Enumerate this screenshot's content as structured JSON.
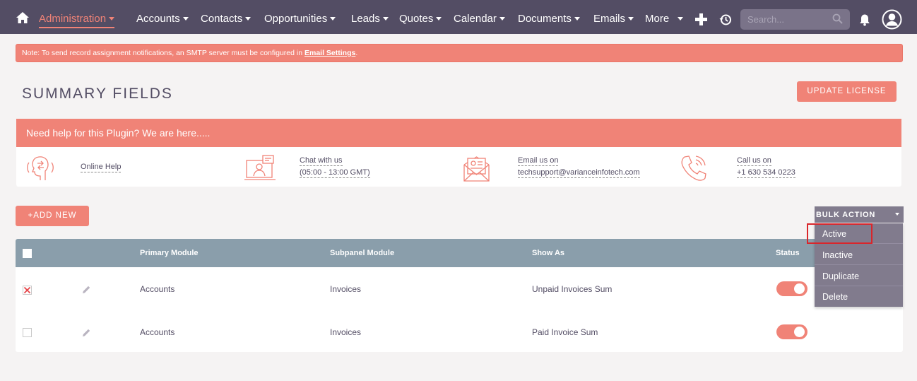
{
  "nav": {
    "items": [
      {
        "label": "Administration",
        "active": true
      },
      {
        "label": "Accounts"
      },
      {
        "label": "Contacts"
      },
      {
        "label": "Opportunities"
      },
      {
        "label": "Leads"
      },
      {
        "label": "Quotes"
      },
      {
        "label": "Calendar"
      },
      {
        "label": "Documents"
      },
      {
        "label": "Emails"
      },
      {
        "label": "More"
      }
    ],
    "search_placeholder": "Search...",
    "icons": [
      "home-icon",
      "plus-icon",
      "history-icon",
      "search-icon",
      "bell-icon",
      "user-icon"
    ]
  },
  "alert": {
    "text": "Note: To send record assignment notifications, an SMTP server must be configured in ",
    "link": "Email Settings",
    "suffix": "."
  },
  "page": {
    "title": "SUMMARY FIELDS",
    "update_license": "UPDATE LICENSE"
  },
  "help": {
    "header": "Need help for this Plugin? We are here.....",
    "online": "Online Help",
    "chat_title": "Chat with us",
    "chat_hours": "(05:00 - 13:00 GMT)",
    "email_title": "Email us on",
    "email": "techsupport@varianceinfotech.com",
    "call_title": "Call us on",
    "phone": "+1 630 534 0223"
  },
  "actions": {
    "add_new": "+ADD NEW",
    "bulk_action": "BULK ACTION",
    "bulk_items": [
      "Active",
      "Inactive",
      "Duplicate",
      "Delete"
    ],
    "highlighted": "Active"
  },
  "table": {
    "headers": {
      "primary": "Primary Module",
      "subpanel": "Subpanel Module",
      "show_as": "Show As",
      "status": "Status"
    },
    "rows": [
      {
        "checked": true,
        "primary": "Accounts",
        "subpanel": "Invoices",
        "show_as": "Unpaid Invoices Sum",
        "status": true
      },
      {
        "checked": false,
        "primary": "Accounts",
        "subpanel": "Invoices",
        "show_as": "Paid Invoice Sum",
        "status": true
      }
    ]
  },
  "colors": {
    "navbar": "#534d64",
    "accent": "#f08377",
    "table_header": "#8a9eab",
    "dropdown": "#817b8d"
  }
}
